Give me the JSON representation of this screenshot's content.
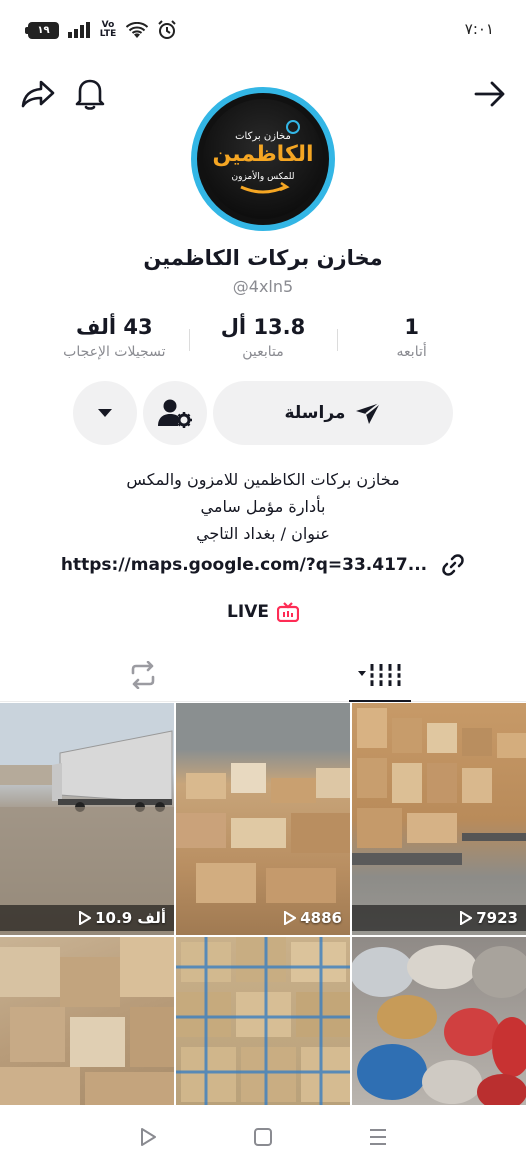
{
  "status_bar": {
    "time": "٧:٠١",
    "battery": "١٩",
    "network": "Vo LTE"
  },
  "profile": {
    "name": "مخازن بركات الكاظمين",
    "handle": "@4xln5",
    "avatar_logo_text": "الكاظمين",
    "avatar_logo_subtitle": "مخازن بركات",
    "avatar_logo_tagline": "للمكس والأمزون"
  },
  "stats": [
    {
      "value": "1",
      "label": "أتابعه"
    },
    {
      "value": "13.8 أل",
      "label": "متابعين"
    },
    {
      "value": "43 ألف",
      "label": "تسجيلات الإعجاب"
    }
  ],
  "actions": {
    "message_label": "مراسلة"
  },
  "bio": {
    "lines": [
      "مخازن بركات الكاظمين للامزون والمكس",
      "بأدارة مؤمل سامي",
      "عنوان / بغداد التاجي"
    ],
    "link": "https://maps.google.com/?q=33.417..."
  },
  "live": {
    "label": "LIVE"
  },
  "videos": [
    {
      "views": "10.9 ألف",
      "caption": true
    },
    {
      "views": "4886",
      "caption": false
    },
    {
      "views": "7923",
      "caption": true
    },
    {
      "views": "",
      "caption": false
    },
    {
      "views": "",
      "caption": false
    },
    {
      "views": "",
      "caption": false
    }
  ],
  "icons": {
    "back": "arrow-right-icon",
    "bell": "bell-icon",
    "share": "share-icon",
    "add_friend": "person-gear-icon",
    "more": "caret-down-icon",
    "send": "send-icon",
    "link": "link-icon",
    "live_badge": "tv-icon",
    "videos_tab": "grid-icon",
    "reposts_tab": "repost-icon"
  },
  "colors": {
    "avatar_ring": "#33b6e5",
    "live_accent": "#fe2c55",
    "primary_text": "#161823",
    "secondary_text": "#8a8b91"
  }
}
